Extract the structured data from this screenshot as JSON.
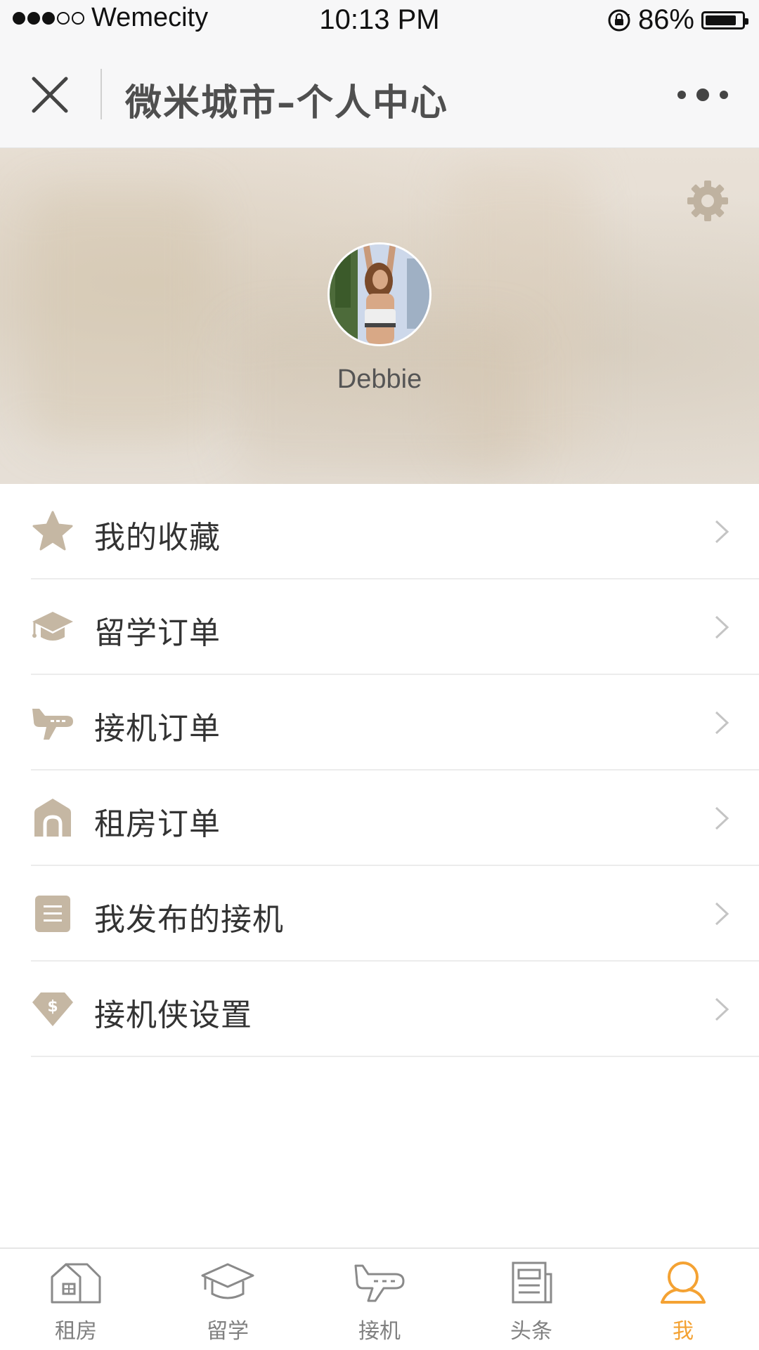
{
  "status_bar": {
    "carrier": "Wemecity",
    "time": "10:13 PM",
    "battery": "86%",
    "battery_level": 0.86
  },
  "nav": {
    "title": "微米城市–个人中心",
    "close_icon": "close-icon",
    "more_icon": "more-icon"
  },
  "profile": {
    "username": "Debbie",
    "settings_icon": "gear-icon"
  },
  "menu": {
    "items": [
      {
        "label": "我的收藏",
        "icon": "star-icon"
      },
      {
        "label": "留学订单",
        "icon": "graduation-cap-icon"
      },
      {
        "label": "接机订单",
        "icon": "airplane-icon"
      },
      {
        "label": "租房订单",
        "icon": "house-icon"
      },
      {
        "label": "我发布的接机",
        "icon": "document-icon"
      },
      {
        "label": "接机侠设置",
        "icon": "dollar-tag-icon"
      }
    ]
  },
  "tabs": [
    {
      "label": "租房",
      "icon": "house-icon",
      "active": false
    },
    {
      "label": "留学",
      "icon": "graduation-cap-icon",
      "active": false
    },
    {
      "label": "接机",
      "icon": "airplane-icon",
      "active": false
    },
    {
      "label": "头条",
      "icon": "newspaper-icon",
      "active": false
    },
    {
      "label": "我",
      "icon": "user-icon",
      "active": true
    }
  ],
  "colors": {
    "accent": "#f4a233",
    "icon_tan": "#c5b7a3",
    "tab_gray": "#808080"
  }
}
